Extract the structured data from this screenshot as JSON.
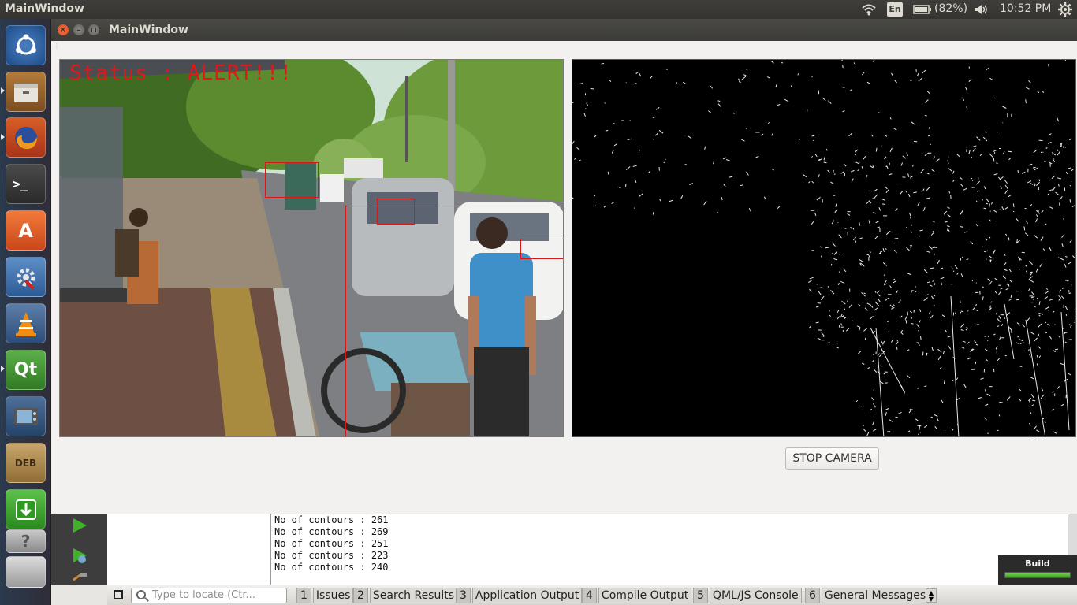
{
  "top_panel": {
    "app_title": "MainWindow",
    "keyboard": "En",
    "battery": "(82%)",
    "clock": "10:52 PM",
    "icons": [
      "wifi-icon",
      "battery-icon",
      "volume-icon",
      "gear-icon"
    ]
  },
  "launcher": {
    "items": [
      {
        "name": "ubuntu-dash-icon",
        "label": ""
      },
      {
        "name": "files-icon",
        "label": ""
      },
      {
        "name": "firefox-icon",
        "label": ""
      },
      {
        "name": "terminal-icon",
        "label": ">_"
      },
      {
        "name": "software-center-icon",
        "label": "A"
      },
      {
        "name": "system-settings-icon",
        "label": ""
      },
      {
        "name": "vlc-icon",
        "label": ""
      },
      {
        "name": "qt-creator-icon",
        "label": "Qt"
      },
      {
        "name": "tv-icon",
        "label": ""
      },
      {
        "name": "deb-package-icon",
        "label": "DEB"
      },
      {
        "name": "update-manager-icon",
        "label": ""
      },
      {
        "name": "unknown-app-icon",
        "label": "?"
      },
      {
        "name": "workspace-icon",
        "label": ""
      }
    ]
  },
  "main_window": {
    "title": "MainWindow",
    "status_overlay": "Status : ALERT!!!",
    "stop_button": "STOP CAMERA"
  },
  "output": {
    "lines": [
      "No of contours : 261",
      "No of contours : 269",
      "No of contours : 251",
      "No of contours : 223",
      "No of contours : 240"
    ]
  },
  "status_bar": {
    "locator_placeholder": "Type to locate (Ctr...",
    "tabs": [
      {
        "num": "1",
        "label": "Issues"
      },
      {
        "num": "2",
        "label": "Search Results"
      },
      {
        "num": "3",
        "label": "Application Output"
      },
      {
        "num": "4",
        "label": "Compile Output"
      },
      {
        "num": "5",
        "label": "QML/JS Console"
      },
      {
        "num": "6",
        "label": "General Messages"
      }
    ]
  },
  "build": {
    "label": "Build",
    "progress": 1.0
  },
  "colors": {
    "alert_red": "#e01818",
    "title_bar": "#3c3b37",
    "close_button": "#e9541f"
  }
}
